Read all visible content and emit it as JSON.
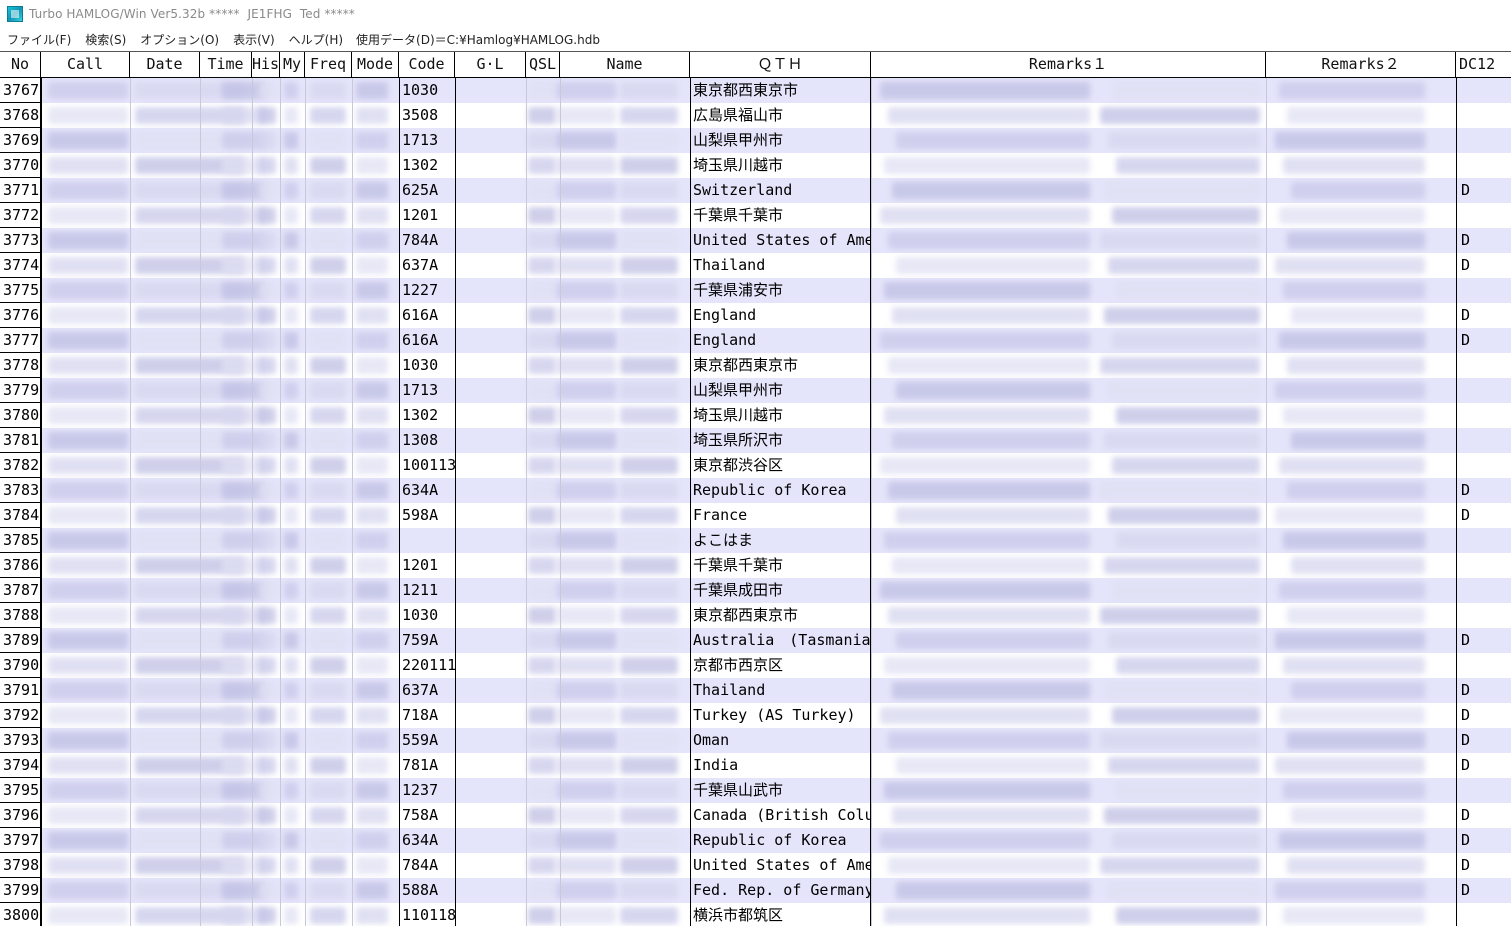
{
  "window": {
    "title": "Turbo HAMLOG/Win Ver5.32b *****  JE1FHG  Ted *****"
  },
  "menu": {
    "items": [
      "ファイル(F)",
      "検索(S)",
      "オプション(O)",
      "表示(V)",
      "ヘルプ(H)"
    ],
    "data_file": "使用データ(D)＝C:¥Hamlog¥HAMLOG.hdb"
  },
  "columns": {
    "no": "No",
    "call": "Call",
    "date": "Date",
    "time": "Time",
    "his": "His",
    "my": "My",
    "freq": "Freq",
    "mode": "Mode",
    "code": "Code",
    "gl": "G·L",
    "qsl": "QSL",
    "name": "Name",
    "qth": "ＱＴＨ",
    "remarks1": "Remarks１",
    "remarks2": "Remarks２",
    "dc12": "DC12"
  },
  "rows": [
    {
      "no": "3767",
      "code": "1030",
      "qth": "東京都西東京市",
      "dc": ""
    },
    {
      "no": "3768",
      "code": "3508",
      "qth": "広島県福山市",
      "dc": ""
    },
    {
      "no": "3769",
      "code": "1713",
      "qth": "山梨県甲州市",
      "dc": ""
    },
    {
      "no": "3770",
      "code": "1302",
      "qth": "埼玉県川越市",
      "dc": ""
    },
    {
      "no": "3771",
      "code": "625A",
      "qth": "Switzerland",
      "dc": "D"
    },
    {
      "no": "3772",
      "code": "1201",
      "qth": "千葉県千葉市",
      "dc": ""
    },
    {
      "no": "3773",
      "code": "784A",
      "qth": "United States of Ameri",
      "dc": "D"
    },
    {
      "no": "3774",
      "code": "637A",
      "qth": "Thailand",
      "dc": "D"
    },
    {
      "no": "3775",
      "code": "1227",
      "qth": "千葉県浦安市",
      "dc": ""
    },
    {
      "no": "3776",
      "code": "616A",
      "qth": "England",
      "dc": "D"
    },
    {
      "no": "3777",
      "code": "616A",
      "qth": "England",
      "dc": "D"
    },
    {
      "no": "3778",
      "code": "1030",
      "qth": "東京都西東京市",
      "dc": ""
    },
    {
      "no": "3779",
      "code": "1713",
      "qth": "山梨県甲州市",
      "dc": ""
    },
    {
      "no": "3780",
      "code": "1302",
      "qth": "埼玉県川越市",
      "dc": ""
    },
    {
      "no": "3781",
      "code": "1308",
      "qth": "埼玉県所沢市",
      "dc": ""
    },
    {
      "no": "3782",
      "code": "100113",
      "qth": "東京都渋谷区",
      "dc": ""
    },
    {
      "no": "3783",
      "code": "634A",
      "qth": "Republic of Korea",
      "dc": "D"
    },
    {
      "no": "3784",
      "code": "598A",
      "qth": "France",
      "dc": "D"
    },
    {
      "no": "3785",
      "code": "",
      "qth": "よこはま",
      "dc": ""
    },
    {
      "no": "3786",
      "code": "1201",
      "qth": "千葉県千葉市",
      "dc": ""
    },
    {
      "no": "3787",
      "code": "1211",
      "qth": "千葉県成田市",
      "dc": ""
    },
    {
      "no": "3788",
      "code": "1030",
      "qth": "東京都西東京市",
      "dc": ""
    },
    {
      "no": "3789",
      "code": "759A",
      "qth": "Australia　(Tasmania",
      "dc": "D"
    },
    {
      "no": "3790",
      "code": "220111",
      "qth": "京都市西京区",
      "dc": ""
    },
    {
      "no": "3791",
      "code": "637A",
      "qth": "Thailand",
      "dc": "D"
    },
    {
      "no": "3792",
      "code": "718A",
      "qth": "Turkey (AS Turkey)",
      "dc": "D"
    },
    {
      "no": "3793",
      "code": "559A",
      "qth": "Oman",
      "dc": "D"
    },
    {
      "no": "3794",
      "code": "781A",
      "qth": "India",
      "dc": "D"
    },
    {
      "no": "3795",
      "code": "1237",
      "qth": "千葉県山武市",
      "dc": ""
    },
    {
      "no": "3796",
      "code": "758A",
      "qth": "Canada (British Columb",
      "dc": "D"
    },
    {
      "no": "3797",
      "code": "634A",
      "qth": "Republic of Korea",
      "dc": "D"
    },
    {
      "no": "3798",
      "code": "784A",
      "qth": "United States of Ameri",
      "dc": "D"
    },
    {
      "no": "3799",
      "code": "588A",
      "qth": "Fed. Rep. of Germany",
      "dc": "D"
    },
    {
      "no": "3800",
      "code": "110118",
      "qth": "横浜市都筑区",
      "dc": ""
    }
  ],
  "colors": {
    "row_band": "#e4e4fa",
    "blur_tint": "#b8b8e0"
  }
}
